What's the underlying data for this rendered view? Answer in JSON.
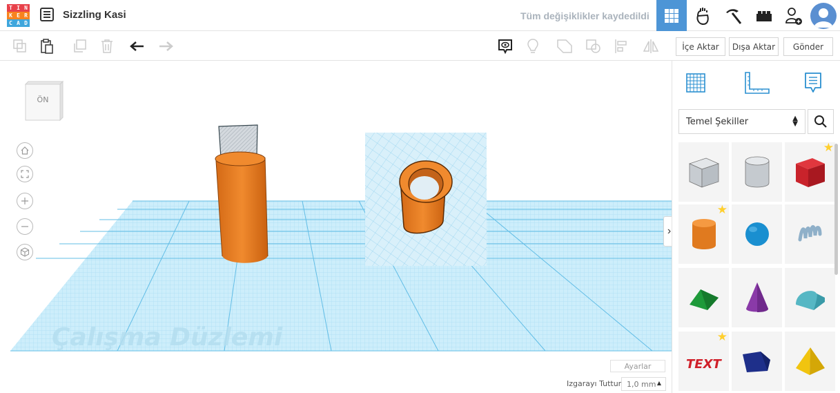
{
  "app": {
    "logo_letters": [
      "T",
      "I",
      "N",
      "K",
      "E",
      "R",
      "C",
      "A",
      "D"
    ],
    "logo_colors": [
      "#e8414a",
      "#e8414a",
      "#e8414a",
      "#f8831e",
      "#f8831e",
      "#f8831e",
      "#3fa6dc",
      "#3fa6dc",
      "#3fa6dc"
    ],
    "design_name": "Sizzling Kasi",
    "save_status": "Tüm değişiklikler kaydedildi",
    "views": [
      {
        "name": "3d-design-view",
        "icon": "grid-icon",
        "active": true
      },
      {
        "name": "blocks-view",
        "icon": "hand-icon",
        "active": false
      },
      {
        "name": "lego-brick-view",
        "icon": "pickaxe-icon",
        "active": false
      },
      {
        "name": "brick-view",
        "icon": "brick-icon",
        "active": false
      }
    ]
  },
  "toolbar": {
    "import_label": "İçe Aktar",
    "export_label": "Dışa Aktar",
    "send_label": "Gönder"
  },
  "viewport": {
    "viewcube_label": "ÖN",
    "workplane_label": "Çalışma Düzlemi",
    "settings_label": "Ayarlar",
    "snap_label": "Izgarayı Tuttur",
    "snap_value": "1,0 mm"
  },
  "panel": {
    "library": "Temel Şekiller",
    "shapes": [
      {
        "name": "box-hole",
        "starred": false
      },
      {
        "name": "cylinder-hole",
        "starred": false
      },
      {
        "name": "box",
        "starred": true
      },
      {
        "name": "cylinder",
        "starred": true
      },
      {
        "name": "sphere",
        "starred": false
      },
      {
        "name": "scribble",
        "starred": false
      },
      {
        "name": "roof",
        "starred": false
      },
      {
        "name": "cone",
        "starred": false
      },
      {
        "name": "round-roof",
        "starred": false
      },
      {
        "name": "text",
        "starred": true,
        "glyph_text": "TEXT"
      },
      {
        "name": "polygon",
        "starred": false
      },
      {
        "name": "pyramid",
        "starred": false
      }
    ]
  },
  "colors": {
    "accent": "#4d95d6",
    "orange": "#e07a1f",
    "grid": "#7ec8ea"
  }
}
